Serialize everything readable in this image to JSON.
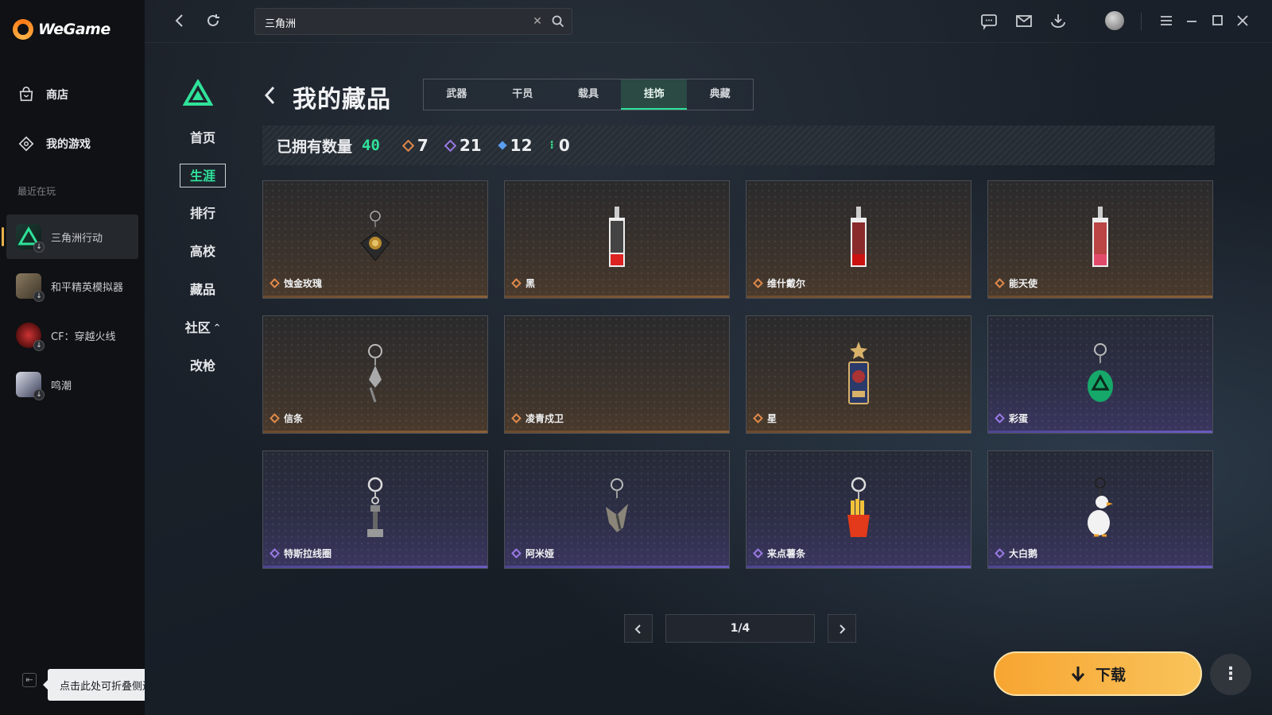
{
  "app": {
    "brand": "WeGame"
  },
  "sidebar": {
    "nav": [
      {
        "label": "商店",
        "icon": "store-icon"
      },
      {
        "label": "我的游戏",
        "icon": "games-icon"
      }
    ],
    "recent_label": "最近在玩",
    "recent": [
      {
        "label": "三角洲行动",
        "active": true
      },
      {
        "label": "和平精英模拟器",
        "active": false
      },
      {
        "label": "CF：穿越火线",
        "active": false
      },
      {
        "label": "鸣潮",
        "active": false
      }
    ],
    "collapse_tooltip": "点击此处可折叠侧边栏"
  },
  "topbar": {
    "search_value": "三角洲"
  },
  "game_nav": {
    "items": [
      "首页",
      "生涯",
      "排行",
      "高校",
      "藏品",
      "社区",
      "改枪"
    ],
    "active": "生涯"
  },
  "page": {
    "title": "我的藏品",
    "tabs": [
      "武器",
      "干员",
      "载具",
      "挂饰",
      "典藏"
    ],
    "active_tab": "挂饰"
  },
  "stats": {
    "label": "已拥有数量",
    "total": "40",
    "counts": [
      {
        "value": "7",
        "color": "#e0894a"
      },
      {
        "value": "21",
        "color": "#9a7ae6"
      },
      {
        "value": "12",
        "color": "#5a9cf0"
      },
      {
        "value": "0",
        "color": "#36d28c"
      }
    ]
  },
  "items": [
    {
      "name": "蚀金玫瑰",
      "rarity": "gold"
    },
    {
      "name": "黑",
      "rarity": "gold"
    },
    {
      "name": "维什戴尔",
      "rarity": "gold"
    },
    {
      "name": "能天使",
      "rarity": "gold"
    },
    {
      "name": "信条",
      "rarity": "gold"
    },
    {
      "name": "凌青戍卫",
      "rarity": "gold"
    },
    {
      "name": "星",
      "rarity": "gold"
    },
    {
      "name": "彩蛋",
      "rarity": "purple"
    },
    {
      "name": "特斯拉线圈",
      "rarity": "purple"
    },
    {
      "name": "阿米娅",
      "rarity": "purple"
    },
    {
      "name": "来点薯条",
      "rarity": "purple"
    },
    {
      "name": "大白鹅",
      "rarity": "purple"
    }
  ],
  "pagination": {
    "text": "1/4"
  },
  "actions": {
    "download": "下载",
    "more": "⋮"
  },
  "colors": {
    "accent": "#2fe29a",
    "gold_rarity": "#e0894a",
    "purple_rarity": "#9a7ae6",
    "download": "#f7a531"
  }
}
